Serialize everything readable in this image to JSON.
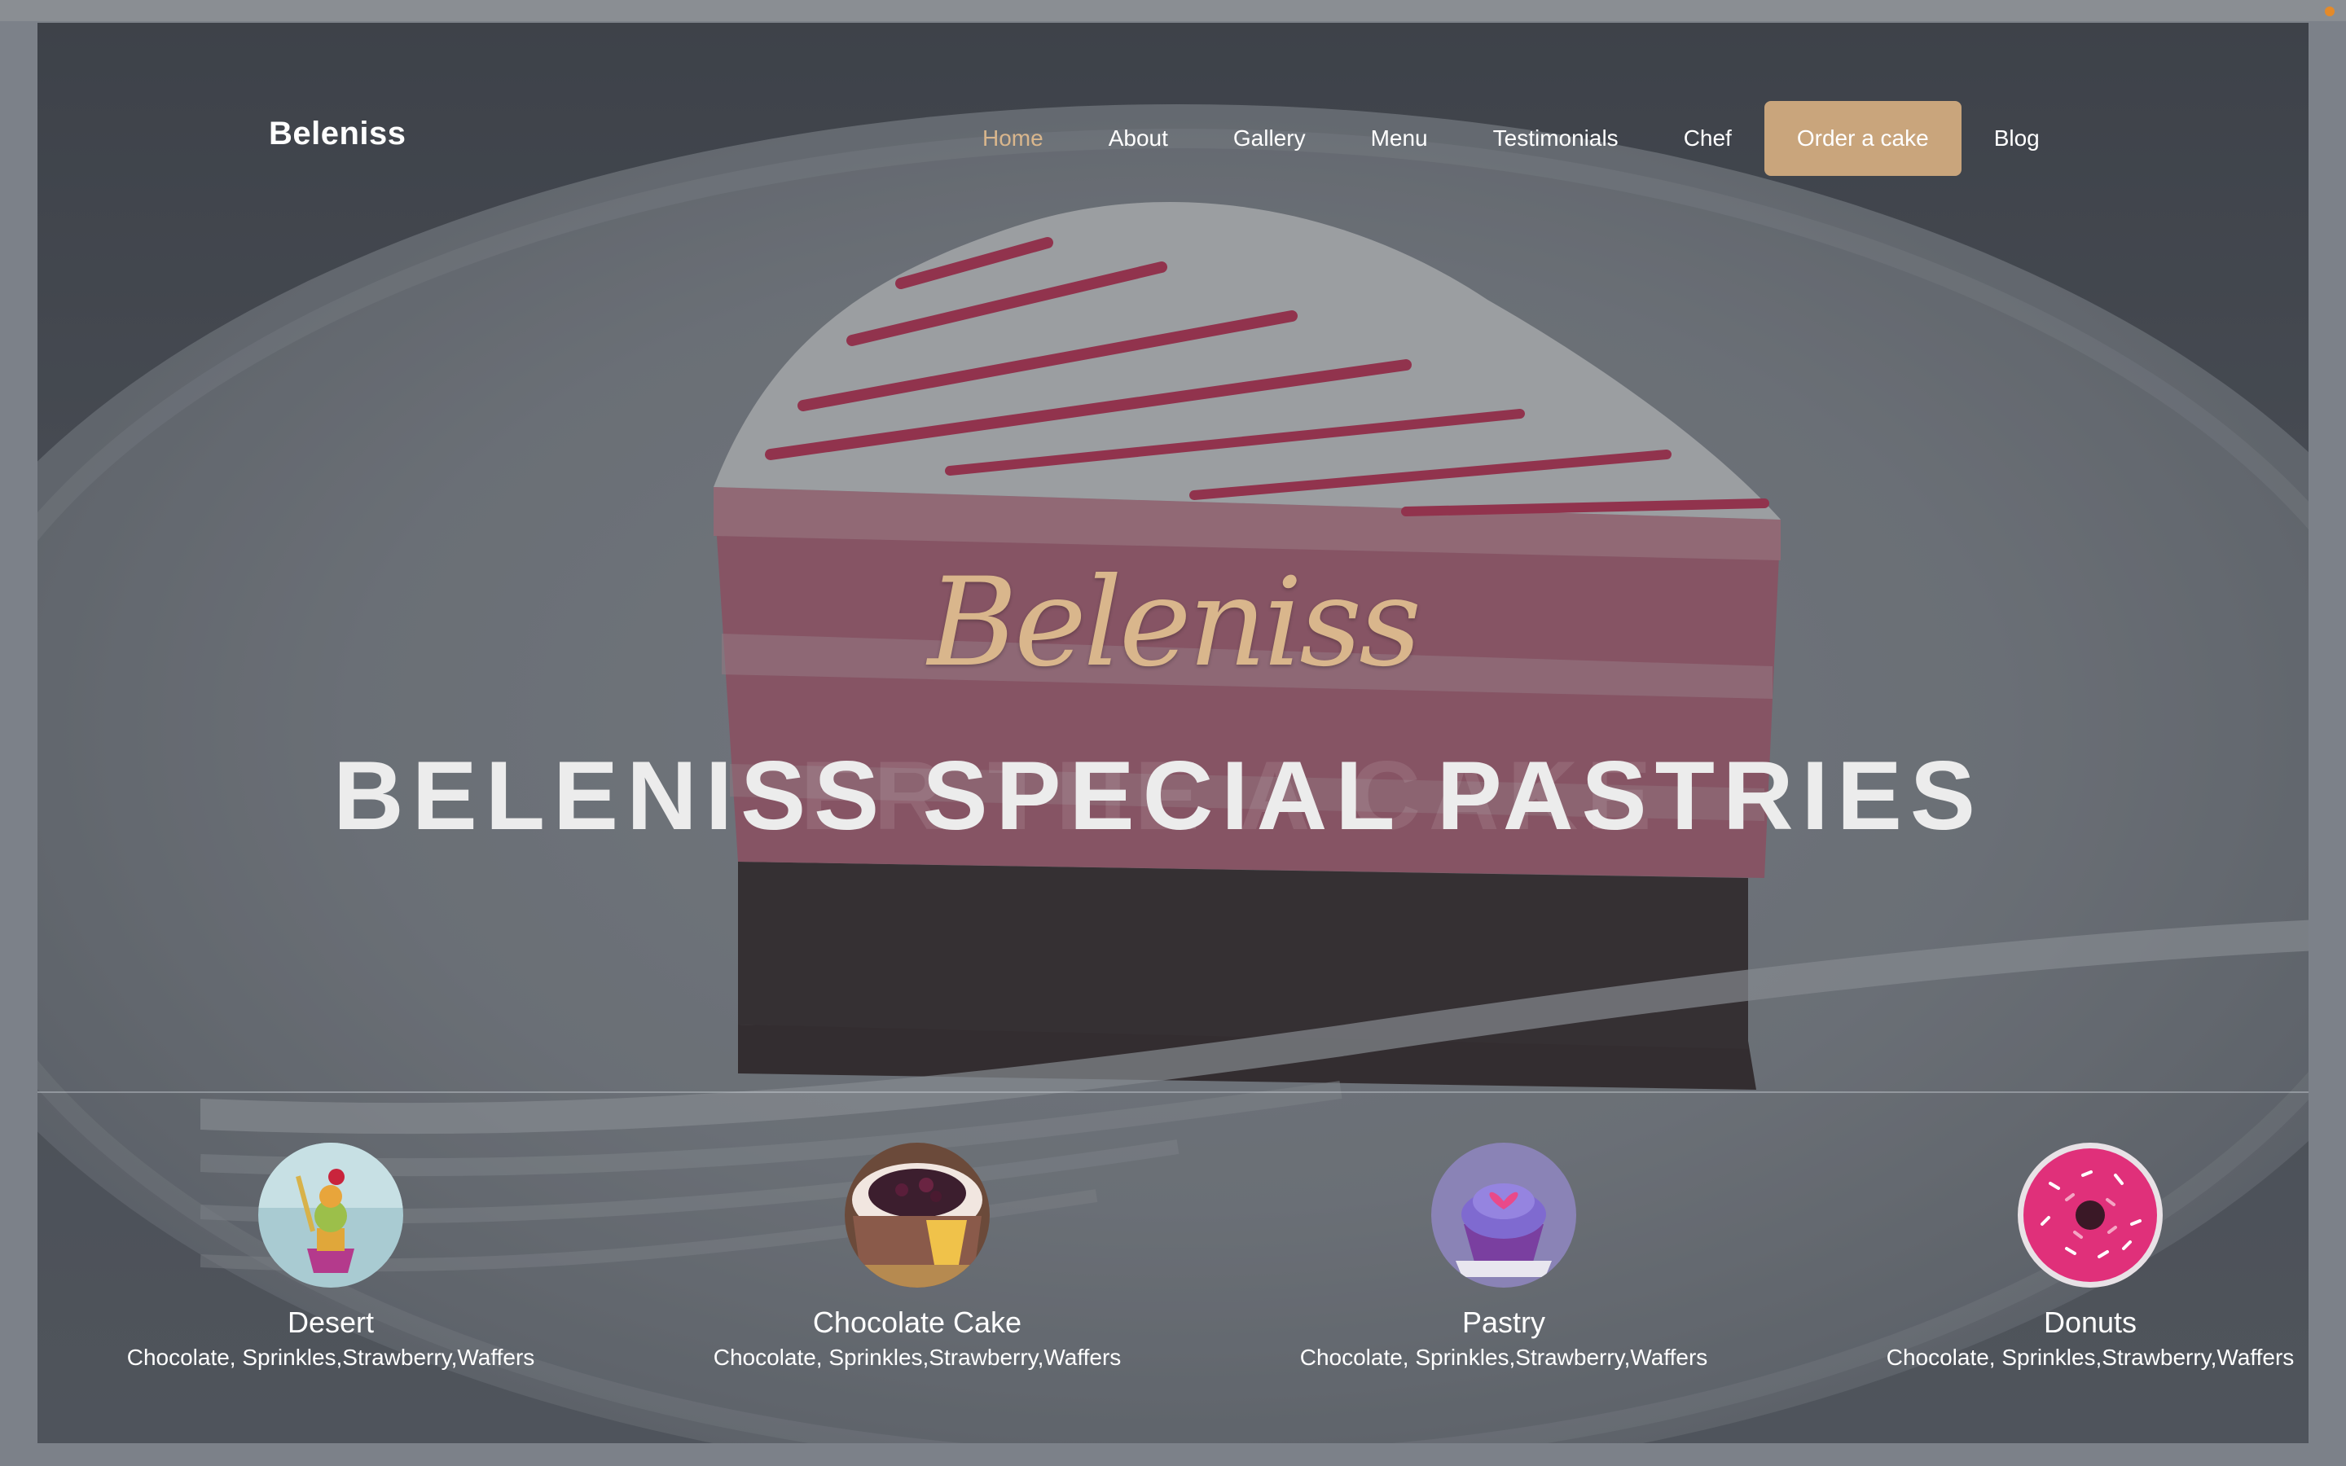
{
  "nav": {
    "brand": "Beleniss",
    "items": [
      {
        "label": "Home",
        "active": true
      },
      {
        "label": "About"
      },
      {
        "label": "Gallery"
      },
      {
        "label": "Menu"
      },
      {
        "label": "Testimonials"
      },
      {
        "label": "Chef"
      },
      {
        "label": "Order a cake",
        "cta": true
      },
      {
        "label": "Blog"
      }
    ]
  },
  "hero": {
    "script_title": "Beleniss",
    "title": "BELENISS SPECIAL PASTRIES",
    "ghost_title": "ER THE A CAKE"
  },
  "categories": [
    {
      "name": "Desert",
      "desc": "Chocolate, Sprinkles,Strawberry,Waffers",
      "icon": "desert-thumbnail"
    },
    {
      "name": "Chocolate Cake",
      "desc": "Chocolate, Sprinkles,Strawberry,Waffers",
      "icon": "chocolate-cake-thumbnail"
    },
    {
      "name": "Pastry",
      "desc": "Chocolate, Sprinkles,Strawberry,Waffers",
      "icon": "pastry-thumbnail"
    },
    {
      "name": "Donuts",
      "desc": "Chocolate, Sprinkles,Strawberry,Waffers",
      "icon": "donuts-thumbnail"
    }
  ],
  "colors": {
    "accent": "#c9a57c",
    "accent_text": "#d9b68c",
    "text": "#ffffff"
  }
}
